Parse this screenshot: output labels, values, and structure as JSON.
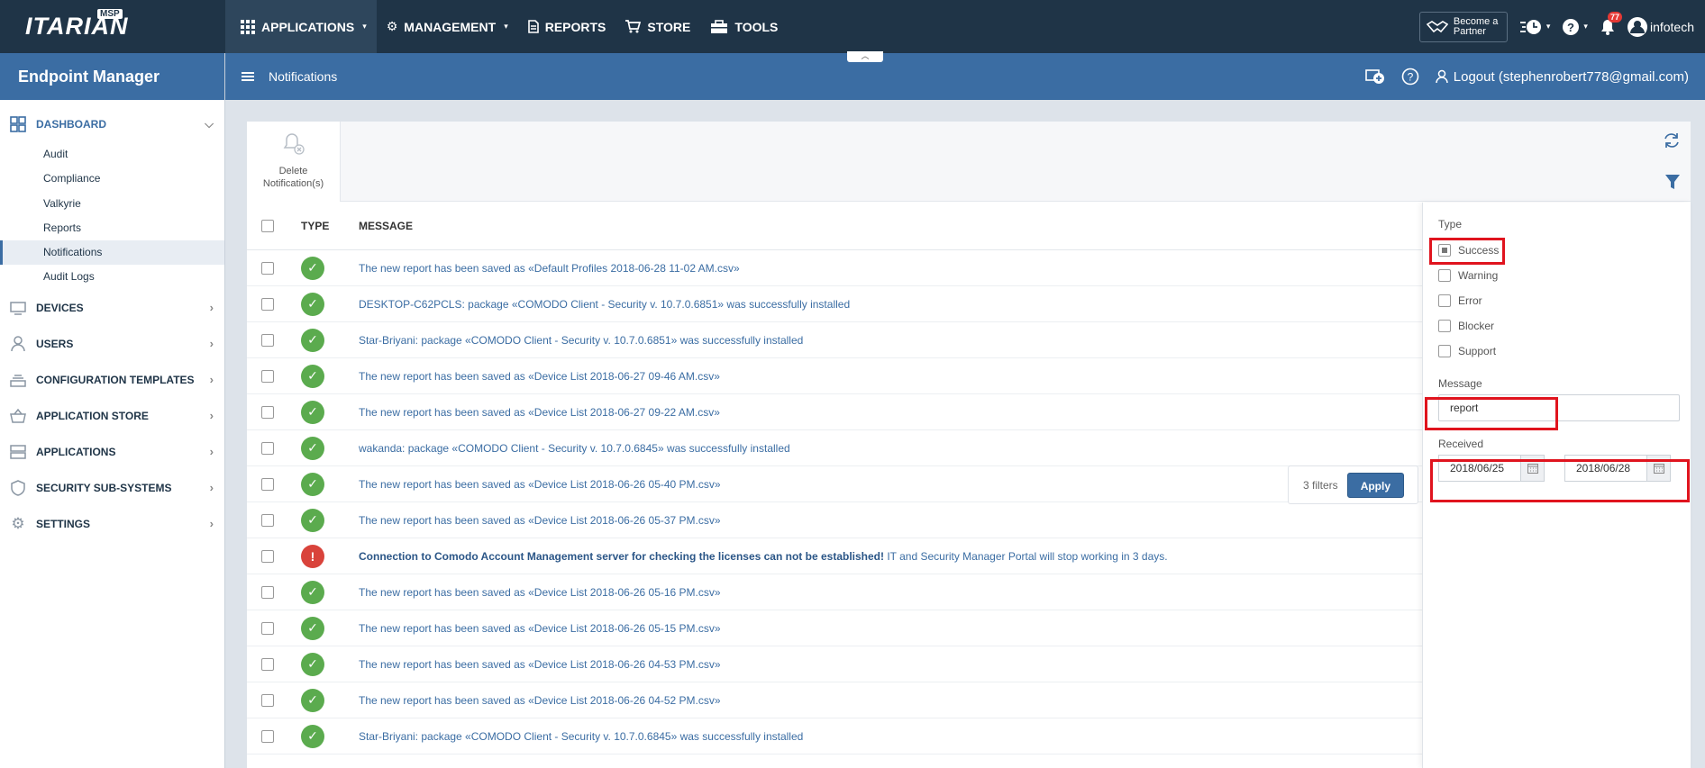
{
  "topbar": {
    "logo": "ITARIAN",
    "logo_badge": "MSP",
    "nav": [
      {
        "label": "APPLICATIONS",
        "icon": "grid-icon"
      },
      {
        "label": "MANAGEMENT",
        "icon": "gears-icon"
      },
      {
        "label": "REPORTS",
        "icon": "document-icon"
      },
      {
        "label": "STORE",
        "icon": "cart-icon"
      },
      {
        "label": "TOOLS",
        "icon": "toolbox-icon"
      }
    ],
    "partner_label": "Become a Partner",
    "notification_count": "77",
    "user": "infotech"
  },
  "sidebar": {
    "title": "Endpoint Manager",
    "dashboard": {
      "label": "DASHBOARD",
      "items": [
        "Audit",
        "Compliance",
        "Valkyrie",
        "Reports",
        "Notifications",
        "Audit Logs"
      ],
      "active": "Notifications"
    },
    "sections": [
      "DEVICES",
      "USERS",
      "CONFIGURATION TEMPLATES",
      "APPLICATION STORE",
      "APPLICATIONS",
      "SECURITY SUB-SYSTEMS",
      "SETTINGS"
    ]
  },
  "subheader": {
    "title": "Notifications",
    "logout": "Logout (stephenrobert778@gmail.com)"
  },
  "toolbar": {
    "delete_label_1": "Delete",
    "delete_label_2": "Notification(s)"
  },
  "table": {
    "headers": {
      "type": "TYPE",
      "message": "MESSAGE"
    },
    "rows": [
      {
        "status": "success",
        "message": "The new report has been saved as «Default Profiles 2018-06-28 11-02 AM.csv»"
      },
      {
        "status": "success",
        "message": "DESKTOP-C62PCLS: package «COMODO Client - Security v. 10.7.0.6851» was successfully installed"
      },
      {
        "status": "success",
        "message": "Star-Briyani: package «COMODO Client - Security v. 10.7.0.6851» was successfully installed"
      },
      {
        "status": "success",
        "message": "The new report has been saved as «Device List 2018-06-27 09-46 AM.csv»"
      },
      {
        "status": "success",
        "message": "The new report has been saved as «Device List 2018-06-27 09-22 AM.csv»"
      },
      {
        "status": "success",
        "message": "wakanda: package «COMODO Client - Security v. 10.7.0.6845» was successfully installed"
      },
      {
        "status": "success",
        "message": "The new report has been saved as «Device List 2018-06-26 05-40 PM.csv»"
      },
      {
        "status": "success",
        "message": "The new report has been saved as «Device List 2018-06-26 05-37 PM.csv»"
      },
      {
        "status": "error",
        "message_bold": "Connection to Comodo Account Management server for checking the licenses can not be established!",
        "message": " IT and Security Manager Portal will stop working in 3 days."
      },
      {
        "status": "success",
        "message": "The new report has been saved as «Device List 2018-06-26 05-16 PM.csv»"
      },
      {
        "status": "success",
        "message": "The new report has been saved as «Device List 2018-06-26 05-15 PM.csv»"
      },
      {
        "status": "success",
        "message": "The new report has been saved as «Device List 2018-06-26 04-53 PM.csv»"
      },
      {
        "status": "success",
        "message": "The new report has been saved as «Device List 2018-06-26 04-52 PM.csv»"
      },
      {
        "status": "success",
        "message": "Star-Briyani: package «COMODO Client - Security v. 10.7.0.6845» was successfully installed"
      }
    ]
  },
  "filter": {
    "type_label": "Type",
    "types": [
      {
        "label": "Success",
        "checked": true
      },
      {
        "label": "Warning",
        "checked": false
      },
      {
        "label": "Error",
        "checked": false
      },
      {
        "label": "Blocker",
        "checked": false
      },
      {
        "label": "Support",
        "checked": false
      }
    ],
    "message_label": "Message",
    "message_value": "report",
    "received_label": "Received",
    "date_from": "2018/06/25",
    "date_to": "2018/06/28",
    "filters_count": "3 filters",
    "apply_label": "Apply"
  },
  "colors": {
    "accent": "#3b6da3",
    "topbar": "#1f3447",
    "success": "#5bab4e",
    "error": "#d9433b",
    "highlight": "#e0141e"
  }
}
